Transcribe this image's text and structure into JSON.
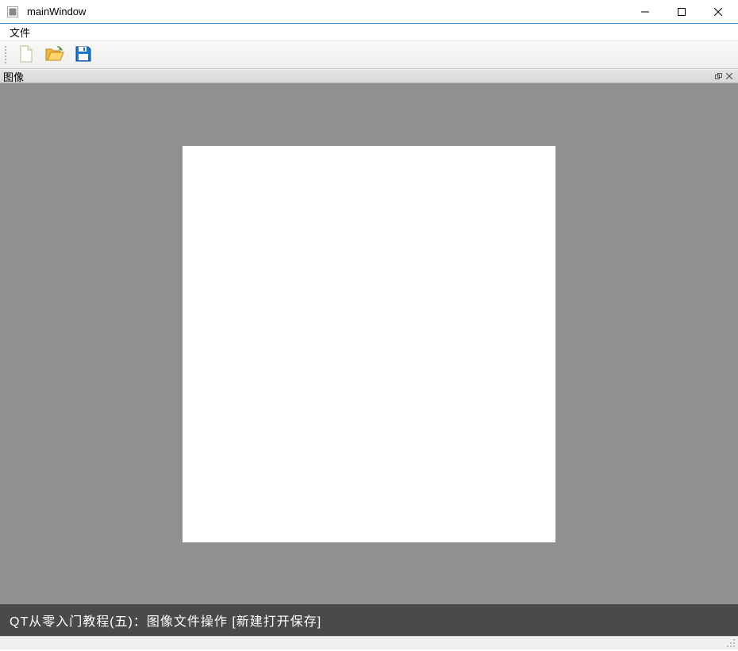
{
  "titlebar": {
    "title": "mainWindow"
  },
  "menubar": {
    "file": "文件"
  },
  "toolbar": {
    "new": "new",
    "open": "open",
    "save": "save"
  },
  "dock": {
    "title": "图像"
  },
  "footer": {
    "text": "QT从零入门教程(五)：图像文件操作 [新建打开保存]"
  }
}
